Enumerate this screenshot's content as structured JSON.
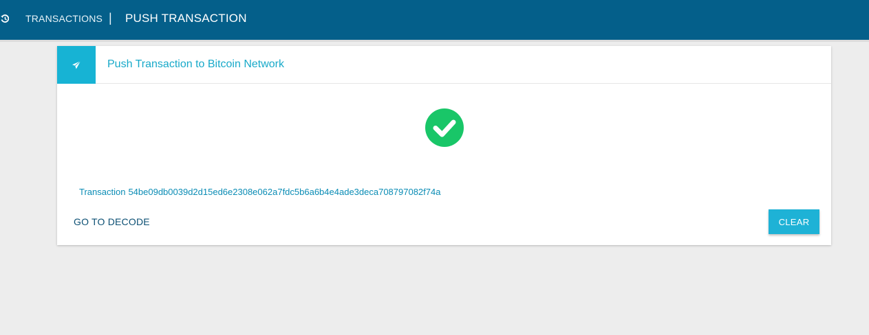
{
  "topbar": {
    "background": "#045f8a",
    "icon": "history-icon",
    "breadcrumb_parent": "TRANSACTIONS",
    "separator": "|",
    "breadcrumb_current": "PUSH TRANSACTION"
  },
  "card": {
    "header_icon": "paper-plane-icon",
    "title": "Push Transaction to Bitcoin Network",
    "status_icon": "check-circle-icon",
    "status_color": "#19c668",
    "tx_prefix": "Transaction",
    "tx_hash": "54be09db0039d2d15ed6e2308e062a7fdc5b6a6b4e4ade3deca708797082f74a",
    "decode_label": "GO TO DECODE",
    "clear_label": "CLEAR",
    "accent": "#17b3d4"
  }
}
